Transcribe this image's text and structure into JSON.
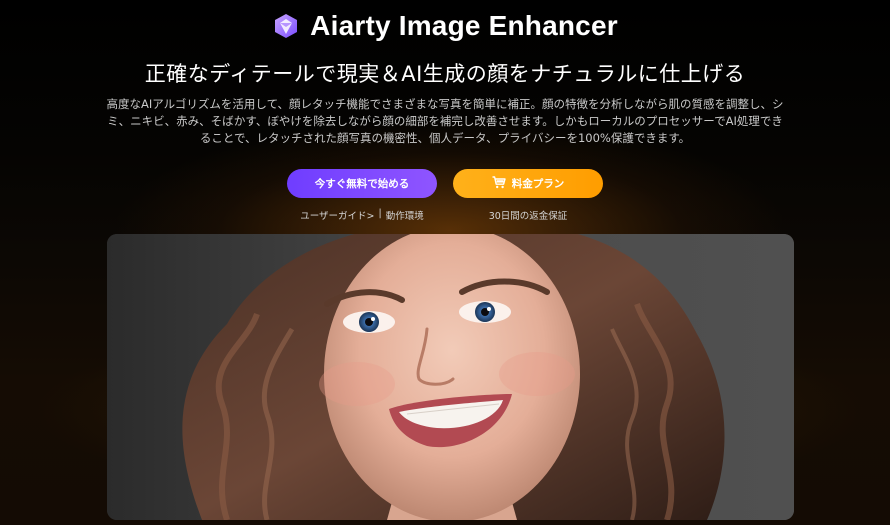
{
  "header": {
    "app_title": "Aiarty Image Enhancer",
    "logo_icon": "hexagon-logo-icon"
  },
  "hero": {
    "headline": "正確なディテールで現実＆AI生成の顔をナチュラルに仕上げる",
    "description": "高度なAIアルゴリズムを活用して、顔レタッチ機能でさまざまな写真を簡単に補正。顔の特徴を分析しながら肌の質感を調整し、シミ、ニキビ、赤み、そばかす、ぼやけを除去しながら顔の細部を補完し改善させます。しかもローカルのプロセッサーでAI処理できることで、レタッチされた顔写真の機密性、個人データ、プライバシーを100%保護できます。"
  },
  "cta": {
    "start_label": "今すぐ無料で始める",
    "pricing_label": "料金プラン",
    "pricing_icon": "cart-icon",
    "user_guide": "ユーザーガイド>",
    "separator": "|",
    "system_req": "動作環境",
    "guarantee": "30日間の返金保証"
  },
  "image": {
    "subject": "smiling-woman-portrait"
  },
  "colors": {
    "start_button": "#7b46ff",
    "pricing_button": "#ffa90f",
    "background": "#000000"
  }
}
